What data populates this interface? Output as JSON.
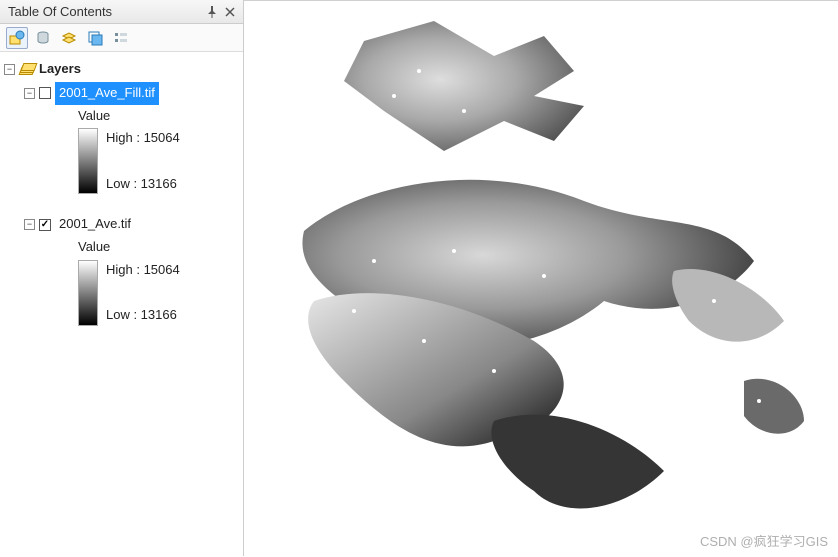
{
  "toc": {
    "title": "Table Of Contents",
    "root_label": "Layers",
    "layers": [
      {
        "name": "2001_Ave_Fill.tif",
        "checked": false,
        "selected": true,
        "value_label": "Value",
        "high_label": "High : 15064",
        "low_label": "Low : 13166"
      },
      {
        "name": "2001_Ave.tif",
        "checked": true,
        "selected": false,
        "value_label": "Value",
        "high_label": "High : 15064",
        "low_label": "Low : 13166"
      }
    ]
  },
  "toolbar_icons": [
    "list-by-drawing-order-icon",
    "list-by-source-icon",
    "list-by-visibility-icon",
    "list-by-selection-icon",
    "options-icon"
  ],
  "watermark": "CSDN @疯狂学习GIS"
}
